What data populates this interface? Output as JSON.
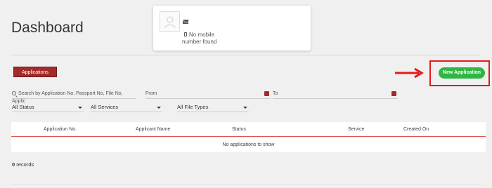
{
  "page": {
    "title": "Dashboard"
  },
  "profile": {
    "mobile_line1": "No mobile",
    "mobile_line2": "number found"
  },
  "tabs": {
    "applications": "Applications"
  },
  "actions": {
    "new_application": "New Application"
  },
  "filters": {
    "search_placeholder": "Search by Application No, Passport No, File No, Applic",
    "from_label": "From",
    "to_label": "To",
    "status_selected": "All Status",
    "services_selected": "All Services",
    "file_types_selected": "All File Types"
  },
  "table": {
    "columns": [
      "Application No.",
      "Applicant Name",
      "Status",
      "Service",
      "Created On"
    ],
    "empty_message": "No applications to show"
  },
  "records": {
    "count": "0",
    "label": "records"
  },
  "colors": {
    "accent": "#a52a2a",
    "success": "#2db742",
    "highlight": "#e31b1b"
  }
}
